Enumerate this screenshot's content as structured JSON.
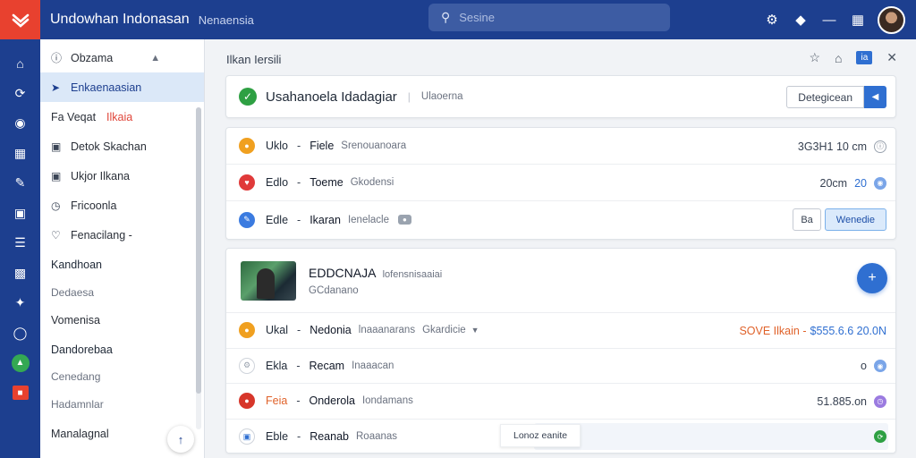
{
  "app": {
    "title": "Undowhan Indonasan",
    "subtitle": "Nenaensia"
  },
  "search": {
    "placeholder": "Sesine"
  },
  "sidebar": {
    "items": [
      {
        "label": "Obzama",
        "icon": "info-icon"
      },
      {
        "label": "Enkaenaasian",
        "icon": "arrow-icon"
      },
      {
        "label": "Fa Veqat",
        "red": "Ilkaia"
      },
      {
        "label": "Detok Skachan",
        "icon": "doc-icon"
      },
      {
        "label": "Ukjor Ilkana",
        "icon": "doc-icon"
      },
      {
        "label": "Fricoonla",
        "icon": "clock-icon"
      },
      {
        "label": "Fenacilang -",
        "icon": "heart-icon"
      },
      {
        "label": "Kandhoan"
      },
      {
        "label": "Dedaesa"
      },
      {
        "label": "Vomenisa"
      },
      {
        "label": "Dandorebaa"
      },
      {
        "label": "Cenedang"
      },
      {
        "label": "Hadamnlar"
      },
      {
        "label": "Manalagnal"
      }
    ]
  },
  "main": {
    "breadcrumb": "Ilkan Iersili",
    "header_badge": "ia",
    "status_card": {
      "title": "Usahanoela Idadagiar",
      "subtitle": "Ulaoerna",
      "button_label": "Detegicean"
    },
    "rows_card": [
      {
        "key": "Uklo",
        "value": "Fiele",
        "desc": "Srenouanoara",
        "right": "3G3H1 10 cm",
        "color": "#f0a020"
      },
      {
        "key": "Edlo",
        "value": "Toeme",
        "desc": "Gkodensi",
        "right": "20cm",
        "right_blue": "20",
        "color": "#e03a3a"
      },
      {
        "key": "Edle",
        "value": "Ikaran",
        "desc": "Ienelacle",
        "btn1": "Ba",
        "btn2": "Wenedie",
        "color": "#3b7be0"
      }
    ],
    "media_card": {
      "title": "EDDCNAJA",
      "title_suffix": "lofensnisaaiai",
      "sub": "GCdanano",
      "rows": [
        {
          "key": "Ukal",
          "value": "Nedonia",
          "desc": "lnaaanarans",
          "desc2": "Gkardicie",
          "price_a": "SOVE Ilkain -",
          "price_b": "$555.6.6 20.0N",
          "color": "#f0a020"
        },
        {
          "key": "Ekla",
          "value": "Recam",
          "desc": "Inaaacan",
          "right": "o",
          "color": "#9aa3af"
        },
        {
          "key": "Feia",
          "value": "Onderola",
          "desc": "Iondamans",
          "right": "51.885.on",
          "color": "#d7362a"
        },
        {
          "key": "Eble",
          "value": "Reanab",
          "desc": "Roaanas",
          "tooltip": "Lonoz eanite",
          "color": "#2f6fd1"
        }
      ]
    }
  },
  "colors": {
    "brand": "#1d3f8f",
    "accent": "#2f6fd1",
    "logo": "#e8412f"
  }
}
